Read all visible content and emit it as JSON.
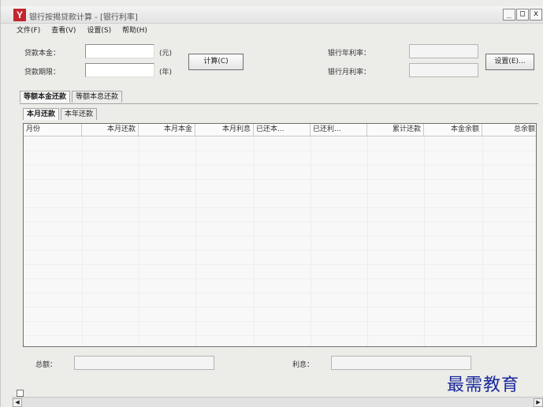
{
  "window": {
    "title": "银行按揭贷款计算 - [银行利率]",
    "icon_glyph": "Y",
    "controls": {
      "minimize": "_",
      "maximize": "□",
      "close": "x"
    }
  },
  "menu": [
    {
      "label": "文件(F)"
    },
    {
      "label": "查看(V)"
    },
    {
      "label": "设置(S)"
    },
    {
      "label": "帮助(H)"
    }
  ],
  "form": {
    "principal_label": "贷款本金：",
    "principal_value": "",
    "principal_unit": "(元)",
    "term_label": "贷款期限：",
    "term_value": "",
    "term_unit": "(年)",
    "calc_button": "计算(C)",
    "annual_rate_label": "银行年利率：",
    "annual_rate_value": "",
    "monthly_rate_label": "银行月利率：",
    "monthly_rate_value": "",
    "settings_button": "设置(E)..."
  },
  "outer_tabs": [
    {
      "label": "等额本金还款",
      "active": true
    },
    {
      "label": "等额本息还款",
      "active": false
    }
  ],
  "inner_tabs": [
    {
      "label": "本月还款",
      "active": true
    },
    {
      "label": "本年还款",
      "active": false
    }
  ],
  "table": {
    "columns": [
      "月份",
      "本月还款",
      "本月本金",
      "本月利息",
      "已还本...",
      "已还利...",
      "累计还款",
      "本金余额",
      "总余额"
    ]
  },
  "summary": {
    "total_label": "总额：",
    "total_value": "",
    "interest_label": "利息：",
    "interest_value": ""
  },
  "watermark": "最需教育"
}
